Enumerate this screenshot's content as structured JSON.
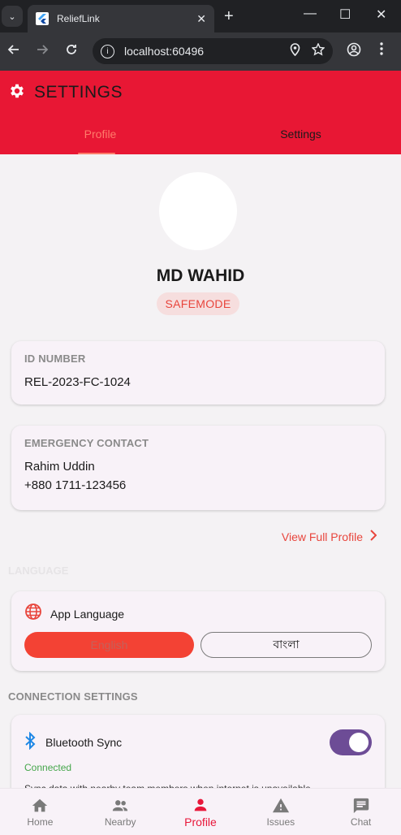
{
  "browser": {
    "tab_title": "ReliefLink",
    "url": "localhost:60496",
    "new_tab_label": "+",
    "tab_close_label": "✕",
    "minimize_label": "—",
    "maximize_label": "☐",
    "close_label": "✕"
  },
  "header": {
    "title": "SETTINGS",
    "tabs": [
      {
        "label": "Profile",
        "active": true
      },
      {
        "label": "Settings",
        "active": false
      }
    ]
  },
  "profile": {
    "name": "MD WAHID",
    "status_badge": "SAFEMODE",
    "id_card": {
      "label": "ID NUMBER",
      "value": "REL-2023-FC-1024"
    },
    "emergency_card": {
      "label": "EMERGENCY CONTACT",
      "contact_name": "Rahim Uddin",
      "contact_phone": "+880 1711-123456"
    },
    "view_full_profile": "View Full Profile"
  },
  "language": {
    "section_title": "LANGUAGE",
    "label": "App Language",
    "options": [
      {
        "label": "English",
        "selected": true
      },
      {
        "label": "বাংলা",
        "selected": false
      }
    ]
  },
  "connection": {
    "section_title": "CONNECTION SETTINGS",
    "bluetooth_label": "Bluetooth Sync",
    "bluetooth_enabled": true,
    "status": "Connected",
    "description": "Sync data with nearby team members when internet is unavailable"
  },
  "bottom_nav": [
    {
      "label": "Home",
      "icon": "home-icon",
      "active": false
    },
    {
      "label": "Nearby",
      "icon": "people-icon",
      "active": false
    },
    {
      "label": "Profile",
      "icon": "person-icon",
      "active": true
    },
    {
      "label": "Issues",
      "icon": "warning-icon",
      "active": false
    },
    {
      "label": "Chat",
      "icon": "chat-icon",
      "active": false
    }
  ],
  "colors": {
    "header_bg": "#e81734",
    "accent": "#e8453c",
    "toggle": "#6d4c96",
    "connected": "#45a64b"
  }
}
